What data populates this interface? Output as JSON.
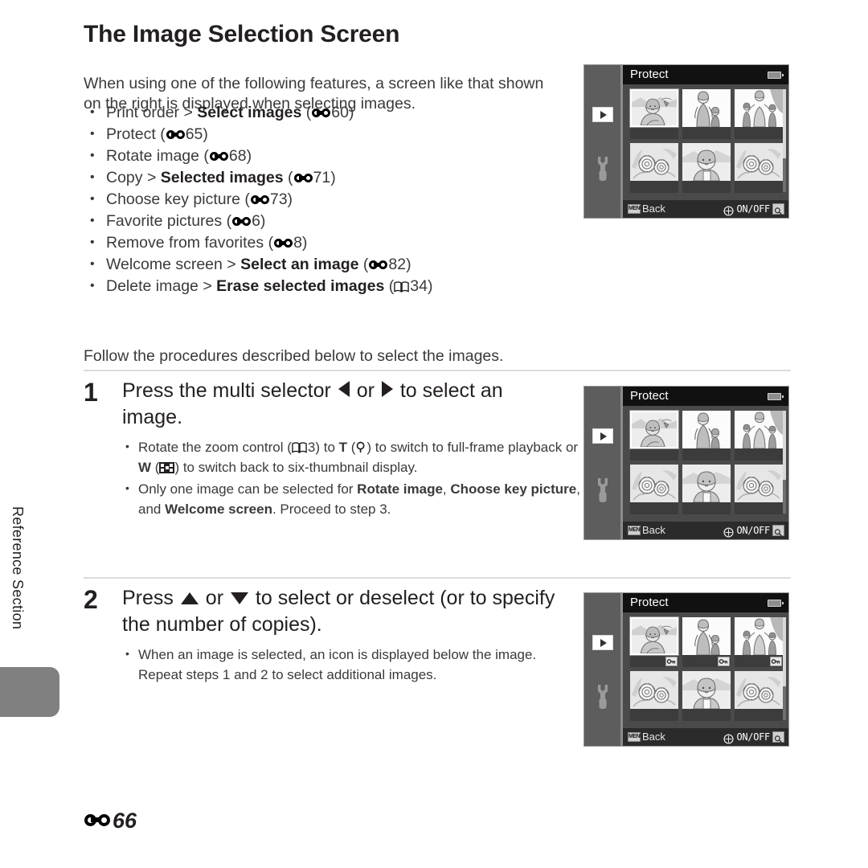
{
  "side_rail": {
    "label": "Reference Section"
  },
  "page": {
    "title": "The Image Selection Screen",
    "intro": "When using one of the following features, a screen like that shown on the right is displayed when selecting images.",
    "follow_text": "Follow the procedures described below to select the images.",
    "folio_number": "66",
    "folio_symbol": "reference-section-symbol"
  },
  "feature_list": [
    {
      "pre": "Print order > ",
      "bold": "Select images",
      "ref_type": "E",
      "ref": "60"
    },
    {
      "pre": "Protect ",
      "bold": "",
      "ref_type": "E",
      "ref": "65"
    },
    {
      "pre": "Rotate image ",
      "bold": "",
      "ref_type": "E",
      "ref": "68"
    },
    {
      "pre": "Copy > ",
      "bold": "Selected images",
      "ref_type": "E",
      "ref": "71"
    },
    {
      "pre": "Choose key picture ",
      "bold": "",
      "ref_type": "E",
      "ref": "73"
    },
    {
      "pre": "Favorite pictures ",
      "bold": "",
      "ref_type": "E",
      "ref": "6"
    },
    {
      "pre": "Remove from favorites ",
      "bold": "",
      "ref_type": "E",
      "ref": "8"
    },
    {
      "pre": "Welcome screen > ",
      "bold": "Select an image",
      "ref_type": "E",
      "ref": "82"
    },
    {
      "pre": "Delete image > ",
      "bold": "Erase selected images",
      "ref_type": "BOOK",
      "ref": "34"
    }
  ],
  "steps": [
    {
      "number": "1",
      "head_part1": "Press the multi selector ",
      "head_icon1": "triangle-left-icon",
      "head_part2": " or ",
      "head_icon2": "triangle-right-icon",
      "head_part3": " to select an image.",
      "substeps": [
        {
          "id": "zoom-control",
          "t1": "Rotate the zoom control (",
          "book_ref": "3",
          "t2": ") to ",
          "tele": "T",
          "t3": " (",
          "mag_icon": "magnifier-icon",
          "t4": ") to switch to full-frame playback or ",
          "wide": "W",
          "t5": " (",
          "thumb_icon": "thumbnail-grid-icon",
          "t6": ") to switch back to six-thumbnail display."
        },
        {
          "id": "single-select-note",
          "t1": "Only one image can be selected for ",
          "b1": "Rotate image",
          "t2": ", ",
          "b2": "Choose key picture",
          "t3": ", and ",
          "b3": "Welcome screen",
          "t4": ". Proceed to step 3."
        }
      ]
    },
    {
      "number": "2",
      "head_part1": "Press ",
      "head_icon1": "triangle-up-icon",
      "head_part2": " or ",
      "head_icon2": "triangle-down-icon",
      "head_part3": " to select or deselect (or to specify the number of copies).",
      "substeps": [
        {
          "id": "selected-icon-note",
          "t1": "When an image is selected, an icon is displayed below the image. Repeat steps 1 and 2 to select additional images.",
          "b1": "",
          "t2": "",
          "b2": "",
          "t3": "",
          "b3": "",
          "t4": ""
        }
      ]
    }
  ],
  "lcd_screens": [
    {
      "id": "screen-initial",
      "title": "Protect",
      "battery_icon": "battery-icon",
      "sidebar": {
        "playback_icon": "playback-icon",
        "setup_icon": "wrench-icon"
      },
      "thumbnails": [
        {
          "scene": "woman-landscape",
          "selected": true,
          "marked": false
        },
        {
          "scene": "woman-child",
          "selected": false,
          "marked": false
        },
        {
          "scene": "family-group",
          "selected": false,
          "marked": false
        },
        {
          "scene": "flowers",
          "selected": false,
          "marked": false
        },
        {
          "scene": "portrait",
          "selected": false,
          "marked": false
        },
        {
          "scene": "flowers",
          "selected": false,
          "marked": false
        }
      ],
      "bottom": {
        "menu_chip": "MENU",
        "back_label": "Back",
        "nav_icon": "multi-selector-icon",
        "onoff_label": "ON/OFF",
        "zoom_icon": "magnifier-button-icon"
      }
    },
    {
      "id": "screen-step1",
      "title": "Protect",
      "battery_icon": "battery-icon",
      "sidebar": {
        "playback_icon": "playback-icon",
        "setup_icon": "wrench-icon"
      },
      "thumbnails": [
        {
          "scene": "woman-landscape",
          "selected": true,
          "marked": false
        },
        {
          "scene": "woman-child",
          "selected": false,
          "marked": false
        },
        {
          "scene": "family-group",
          "selected": false,
          "marked": false
        },
        {
          "scene": "flowers",
          "selected": false,
          "marked": false
        },
        {
          "scene": "portrait",
          "selected": false,
          "marked": false
        },
        {
          "scene": "flowers",
          "selected": false,
          "marked": false
        }
      ],
      "bottom": {
        "menu_chip": "MENU",
        "back_label": "Back",
        "nav_icon": "multi-selector-icon",
        "onoff_label": "ON/OFF",
        "zoom_icon": "magnifier-button-icon"
      }
    },
    {
      "id": "screen-step2",
      "title": "Protect",
      "battery_icon": "battery-icon",
      "sidebar": {
        "playback_icon": "playback-icon",
        "setup_icon": "wrench-icon"
      },
      "thumbnails": [
        {
          "scene": "woman-landscape",
          "selected": true,
          "marked": true
        },
        {
          "scene": "woman-child",
          "selected": false,
          "marked": true
        },
        {
          "scene": "family-group",
          "selected": false,
          "marked": true
        },
        {
          "scene": "flowers",
          "selected": false,
          "marked": false
        },
        {
          "scene": "portrait",
          "selected": false,
          "marked": false
        },
        {
          "scene": "flowers",
          "selected": false,
          "marked": false
        }
      ],
      "bottom": {
        "menu_chip": "MENU",
        "back_label": "Back",
        "nav_icon": "multi-selector-icon",
        "onoff_label": "ON/OFF",
        "zoom_icon": "magnifier-button-icon"
      }
    }
  ]
}
